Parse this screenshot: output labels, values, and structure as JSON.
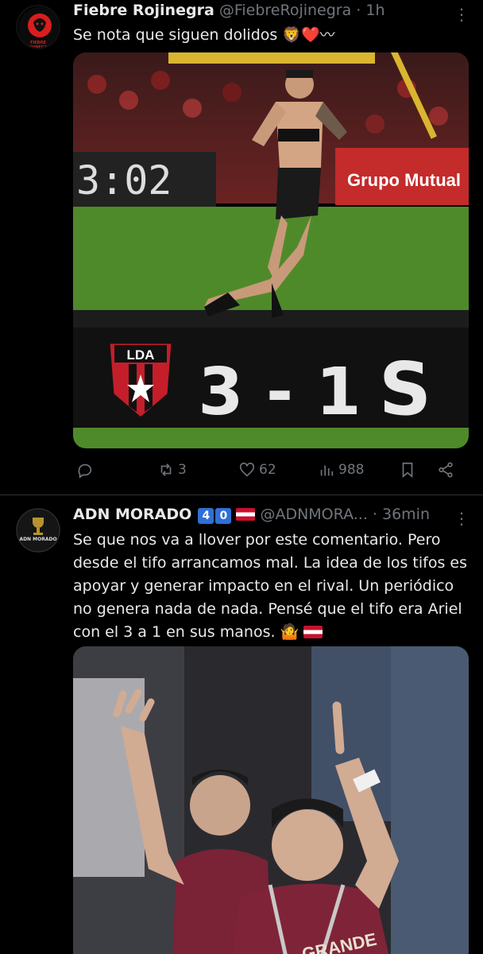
{
  "tweets": [
    {
      "name": "Fiebre Rojinegra",
      "handle": "@FiebreRojinegra",
      "time": "· 1h",
      "avatar_text": "FIEBRE ROJINEGRA",
      "text": "Se nota que siguen dolidos 🦁❤️〰",
      "media": {
        "scoreboard_clock": "3:02",
        "banner_text": "Grupo Mutual",
        "team_badge": "LDA",
        "score": "3 - 1",
        "opponent": "S"
      },
      "actions": {
        "replies": "",
        "retweets": "3",
        "likes": "62",
        "views": "988"
      }
    },
    {
      "name": "ADN MORADO",
      "badges": [
        "4",
        "0"
      ],
      "handle": "@ADNMORA...",
      "time": "· 36min",
      "avatar_text": "ADN MORADO",
      "text": "Se que nos va a llover por este comentario. Pero desde el tifo arrancamos mal. La idea de los tifos es apoyar y generar impacto en el rival. Un periódico no genera nada de nada.  Pensé que el tifo era Ariel con el 3 a 1 en sus manos. 🤷",
      "media": {
        "jersey_text": "GRANDE"
      }
    }
  ],
  "colors": {
    "background": "#000000",
    "text": "#e7e9ea",
    "muted": "#71767b",
    "divider": "#2f3336"
  }
}
